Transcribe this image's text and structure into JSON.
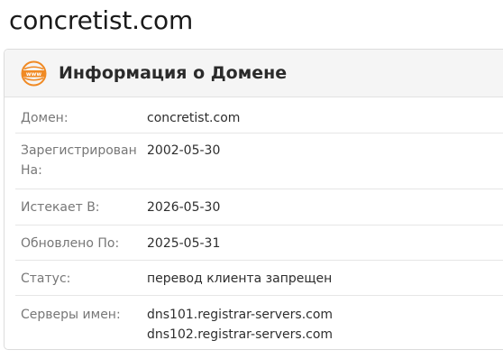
{
  "site_title": "concretist.com",
  "card": {
    "icon": "www-globe-icon",
    "title": "Информация о Домене"
  },
  "rows": [
    {
      "label": "Домен:",
      "value": "concretist.com"
    },
    {
      "label": "Зарегистрирован На:",
      "value": "2002-05-30"
    },
    {
      "label": "Истекает В:",
      "value": "2026-05-30"
    },
    {
      "label": "Обновлено По:",
      "value": "2025-05-31"
    },
    {
      "label": "Статус:",
      "value": "перевод клиента запрещен"
    },
    {
      "label": "Серверы имен:",
      "values": [
        "dns101.registrar-servers.com",
        "dns102.registrar-servers.com"
      ]
    }
  ],
  "colors": {
    "icon_orange": "#f08a24",
    "label_gray": "#777777",
    "text_dark": "#2e2e2e"
  }
}
